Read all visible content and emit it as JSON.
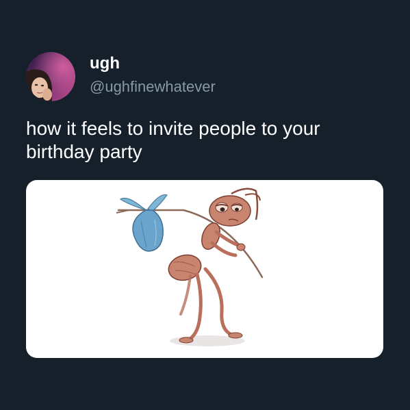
{
  "tweet": {
    "author": {
      "display_name": "ugh",
      "handle": "@ughfinewhatever",
      "avatar_icon": "profile-photo"
    },
    "text": "how it feels to invite people to your birthday party",
    "media": {
      "icon": "sad-ant-with-bindle-illustration"
    }
  },
  "colors": {
    "background": "#15202b",
    "text_primary": "#ffffff",
    "text_secondary": "#8899a6",
    "media_background": "#ffffff"
  }
}
